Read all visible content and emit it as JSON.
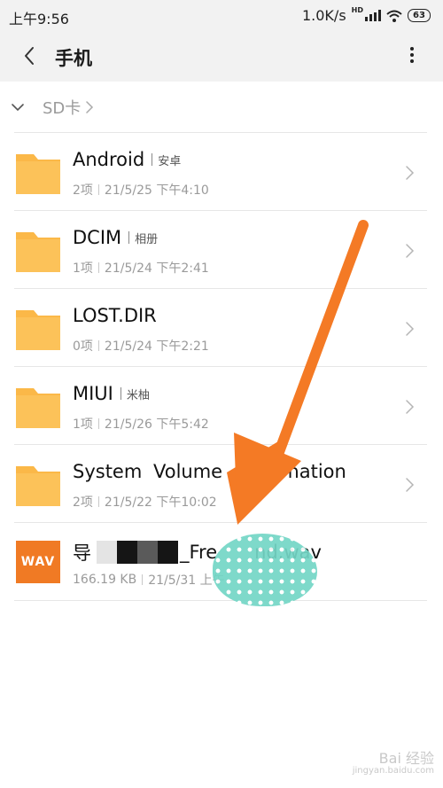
{
  "status_bar": {
    "time": "上午9:56",
    "network_speed": "1.0K/s",
    "network_type": "HD",
    "battery": "63",
    "icons": [
      "signal-icon",
      "wifi-icon",
      "battery-icon"
    ]
  },
  "header": {
    "title": "手机",
    "back_icon": "chevron-left-icon",
    "more_icon": "more-vertical-icon"
  },
  "breadcrumb": {
    "label": "SD卡",
    "toggle_icon": "chevron-down-icon",
    "separator_icon": "chevron-right-icon"
  },
  "files": [
    {
      "type": "folder",
      "name": "Android",
      "alias": "安卓",
      "count": "2项",
      "date": "21/5/25 下午4:10"
    },
    {
      "type": "folder",
      "name": "DCIM",
      "alias": "相册",
      "count": "1项",
      "date": "21/5/24 下午2:41"
    },
    {
      "type": "folder",
      "name": "LOST.DIR",
      "alias": "",
      "count": "0项",
      "date": "21/5/24 下午2:21"
    },
    {
      "type": "folder",
      "name": "MIUI",
      "alias": "米柚",
      "count": "1项",
      "date": "21/5/26 下午5:42"
    },
    {
      "type": "folder",
      "name": "System Volume In",
      "name_end": "mation",
      "alias": "",
      "count": "2项",
      "date": "21/5/22 下午10:02"
    },
    {
      "type": "wav",
      "icon_label": "WAV",
      "name_start": "导",
      "name_end": "_Fre",
      "name_tail": "nd.wav",
      "size": "166.19 KB",
      "date": "21/5/31 上午"
    }
  ],
  "colors": {
    "folder": "#fbb848",
    "wav": "#f07a24",
    "arrow": "#f47a25",
    "blob": "#74d6c6",
    "background": "#ffffff",
    "header_bg": "#f2f2f2"
  },
  "watermark": {
    "text": "Bai 经验",
    "sub": "jingyan.baidu.com"
  }
}
